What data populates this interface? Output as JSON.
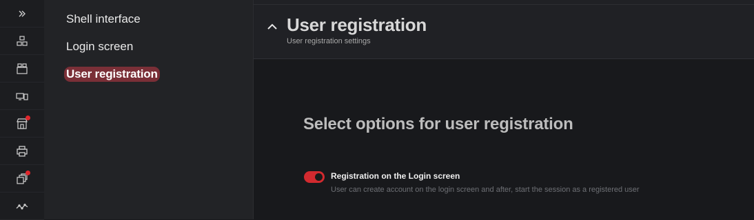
{
  "rail": {
    "items": [
      {
        "icon": "double-chevron-right-icon"
      },
      {
        "icon": "modules-icon"
      },
      {
        "icon": "apps-icon"
      },
      {
        "icon": "devices-icon"
      },
      {
        "icon": "store-icon",
        "badge": true
      },
      {
        "icon": "printer-icon"
      },
      {
        "icon": "windows-stack-icon",
        "badge": true
      },
      {
        "icon": "chart-line-icon"
      }
    ],
    "badge_color": "#e0262b"
  },
  "nav": {
    "items": [
      {
        "label": "Shell interface",
        "active": false
      },
      {
        "label": "Login screen",
        "active": false
      },
      {
        "label": "User registration",
        "active": true
      }
    ],
    "accent": "#7a2f37"
  },
  "section": {
    "title": "User registration",
    "subtitle": "User registration settings",
    "expanded": true
  },
  "options": {
    "heading": "Select options for user registration",
    "items": [
      {
        "label": "Registration on the Login screen",
        "description": "User can create account on the login screen and after, start the session as a registered user",
        "enabled": true
      }
    ],
    "toggle_color": "#d22a2f"
  }
}
